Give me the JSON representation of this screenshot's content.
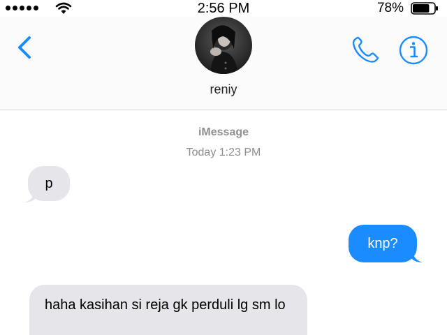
{
  "status_bar": {
    "time": "2:56 PM",
    "battery_percent": "78%",
    "battery_level": 0.78,
    "signal_bars": 5
  },
  "header": {
    "contact_name": "reniy",
    "icons": {
      "back": "chevron-left-icon",
      "call": "phone-icon",
      "info": "info-icon"
    }
  },
  "conversation": {
    "service_label": "iMessage",
    "timestamp": "Today 1:23 PM",
    "messages": [
      {
        "direction": "incoming",
        "text": "p"
      },
      {
        "direction": "outgoing",
        "text": "knp?"
      },
      {
        "direction": "incoming",
        "text": "haha kasihan si reja gk perduli lg sm lo"
      }
    ]
  },
  "colors": {
    "accent": "#1a8cff",
    "incoming_bubble": "#e5e5ea",
    "outgoing_bubble": "#1a8cff",
    "meta_text": "#8e8e93"
  }
}
